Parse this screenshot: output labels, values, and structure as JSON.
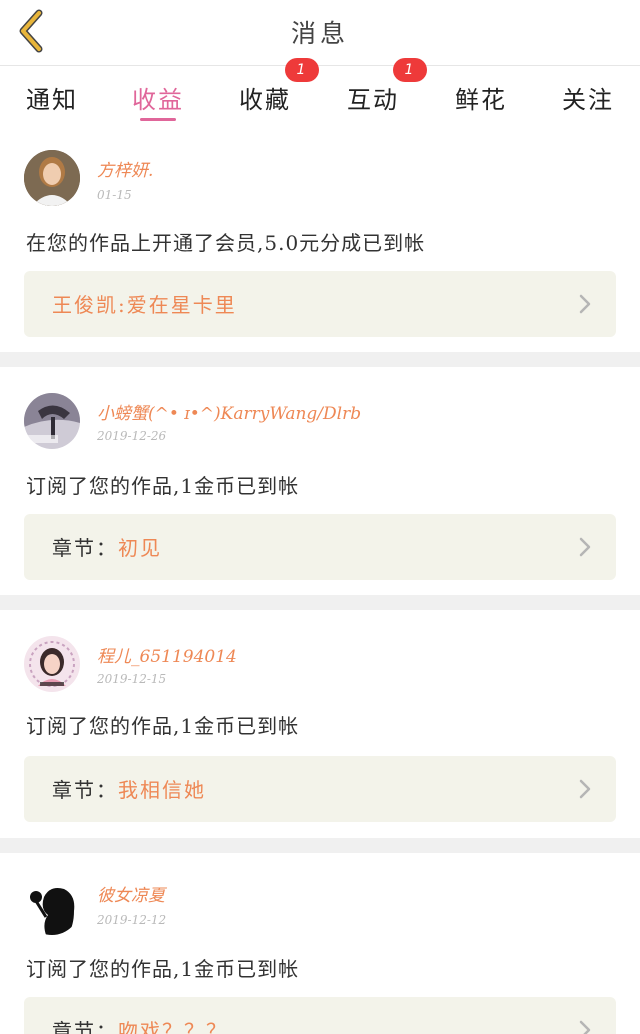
{
  "header": {
    "title": "消息"
  },
  "tabs": [
    {
      "label": "通知",
      "active": false,
      "badge": ""
    },
    {
      "label": "收益",
      "active": true,
      "badge": ""
    },
    {
      "label": "收藏",
      "active": false,
      "badge": "1"
    },
    {
      "label": "互动",
      "active": false,
      "badge": "1"
    },
    {
      "label": "鲜花",
      "active": false,
      "badge": ""
    },
    {
      "label": "关注",
      "active": false,
      "badge": ""
    }
  ],
  "messages": [
    {
      "username": "方梓妍.",
      "date": "01-15",
      "text": "在您的作品上开通了会员,5.0元分成已到帐",
      "link_prefix": "",
      "link_value": "王俊凯:爱在星卡里"
    },
    {
      "username": "小螃蟹(^• ɪ•^)KarryWang/Dlrb",
      "date": "2019-12-26",
      "text": "订阅了您的作品,1金币已到帐",
      "link_prefix": "章节：",
      "link_value": "初见"
    },
    {
      "username": "程儿_651194014",
      "date": "2019-12-15",
      "text": "订阅了您的作品,1金币已到帐",
      "link_prefix": "章节：",
      "link_value": "我相信她"
    },
    {
      "username": "彼女凉夏",
      "date": "2019-12-12",
      "text": "订阅了您的作品,1金币已到帐",
      "link_prefix": "章节：",
      "link_value": "吻戏？？？"
    }
  ],
  "colors": {
    "accent": "#e0669a",
    "name": "#ee8855",
    "badge": "#ee3a3a",
    "back": "#e8b53a"
  },
  "icons": {
    "back": "back-arrow-icon",
    "chevron": "chevron-right-icon"
  }
}
